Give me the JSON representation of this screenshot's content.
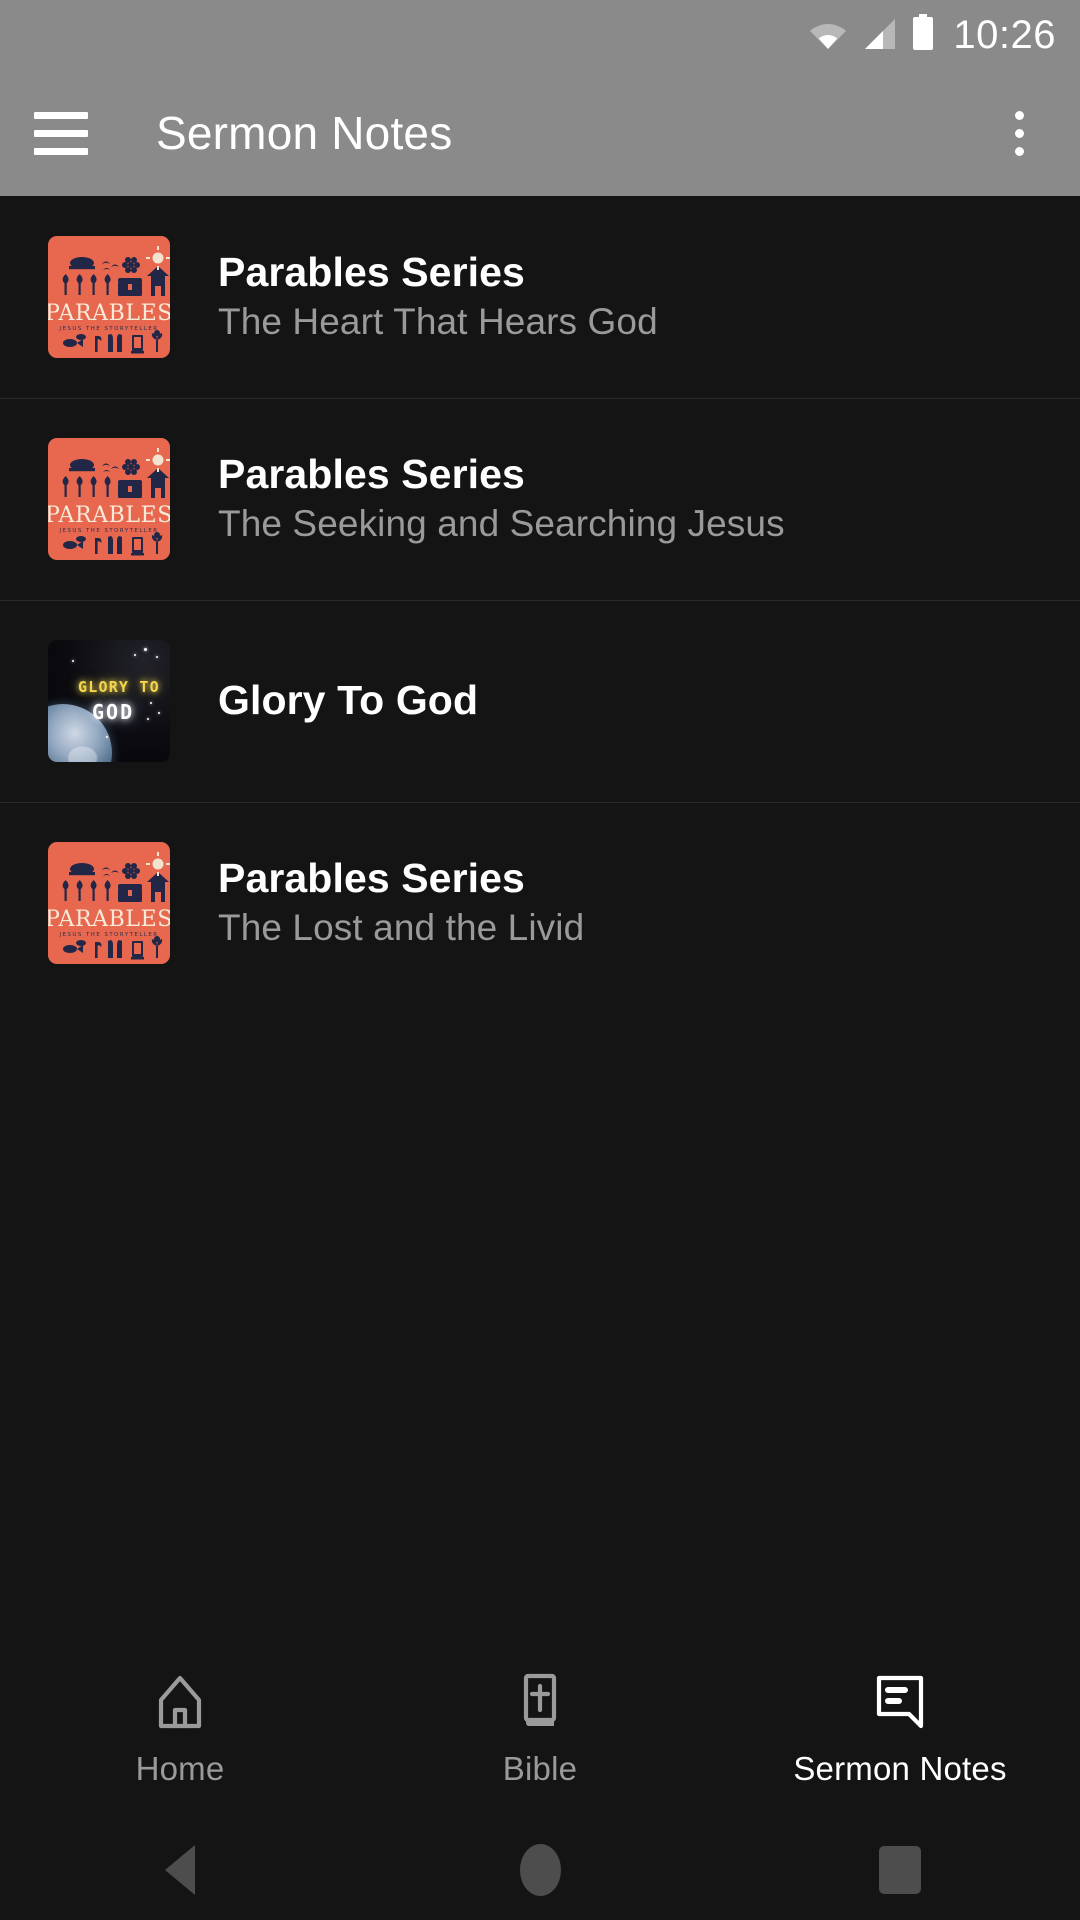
{
  "status_bar": {
    "time": "10:26",
    "icons": [
      "wifi-icon",
      "cellular-signal-icon",
      "battery-icon"
    ]
  },
  "app_bar": {
    "menu_icon": "hamburger-menu-icon",
    "title": "Sermon Notes",
    "overflow_icon": "overflow-menu-icon",
    "background_color": "#8a8a8a"
  },
  "theme": {
    "background": "#141414",
    "accent": "#e8684f",
    "title_color": "#ffffff",
    "subtitle_color": "#9a9a9a",
    "divider": "#2a2a2a"
  },
  "sermon_list": [
    {
      "title": "Parables Series",
      "subtitle": "The Heart That Hears God",
      "thumbnail": "parables-series-artwork",
      "artwork_text": {
        "main": "PARABLES",
        "tagline": "JESUS THE STORYTELLER"
      }
    },
    {
      "title": "Parables Series",
      "subtitle": "The Seeking and Searching Jesus",
      "thumbnail": "parables-series-artwork",
      "artwork_text": {
        "main": "PARABLES",
        "tagline": "JESUS THE STORYTELLER"
      }
    },
    {
      "title": "Glory To God",
      "subtitle": "",
      "thumbnail": "glory-to-god-artwork",
      "artwork_text": {
        "line1": "GLORY TO",
        "line2": "GOD"
      }
    },
    {
      "title": "Parables Series",
      "subtitle": "The Lost and the Livid",
      "thumbnail": "parables-series-artwork",
      "artwork_text": {
        "main": "PARABLES",
        "tagline": "JESUS THE STORYTELLER"
      }
    }
  ],
  "bottom_nav": [
    {
      "label": "Home",
      "icon": "home-church-icon",
      "active": false
    },
    {
      "label": "Bible",
      "icon": "bible-book-icon",
      "active": false
    },
    {
      "label": "Sermon Notes",
      "icon": "sermon-notes-speech-bubble-icon",
      "active": true
    }
  ],
  "system_nav": {
    "back": "back-triangle-icon",
    "home": "home-circle-icon",
    "recents": "recents-square-icon"
  }
}
